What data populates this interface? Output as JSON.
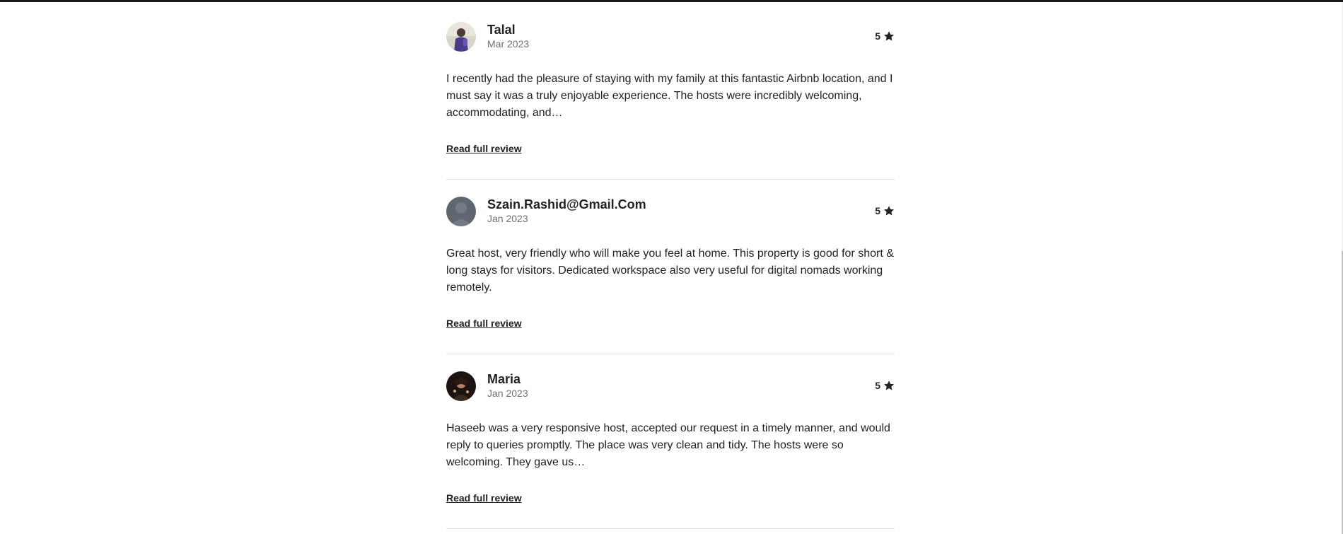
{
  "reviews": [
    {
      "name": "Talal",
      "date": "Mar 2023",
      "rating": "5",
      "text": "I recently had the pleasure of staying with my family at this fantastic Airbnb location, and I must say it was a truly enjoyable experience. The hosts were incredibly welcoming, accommodating, and…",
      "read_more_label": "Read full review",
      "avatar": "photo"
    },
    {
      "name": "Szain.Rashid@Gmail.Com",
      "date": "Jan 2023",
      "rating": "5",
      "text": "Great host, very friendly who will make you feel at home. This property is good for short & long stays for visitors. Dedicated workspace also very useful for digital nomads working remotely.",
      "read_more_label": "Read full review",
      "avatar": "default-silhouette"
    },
    {
      "name": "Maria",
      "date": "Jan 2023",
      "rating": "5",
      "text": "Haseeb was a very responsive host, accepted our request in a timely manner, and would reply to queries promptly. The place was very clean and tidy. The hosts were so welcoming. They gave us…",
      "read_more_label": "Read full review",
      "avatar": "photo"
    }
  ],
  "icons": {
    "rating": "star-icon"
  },
  "colors": {
    "text": "#222222",
    "muted": "#717171",
    "divider": "#dddddd"
  }
}
